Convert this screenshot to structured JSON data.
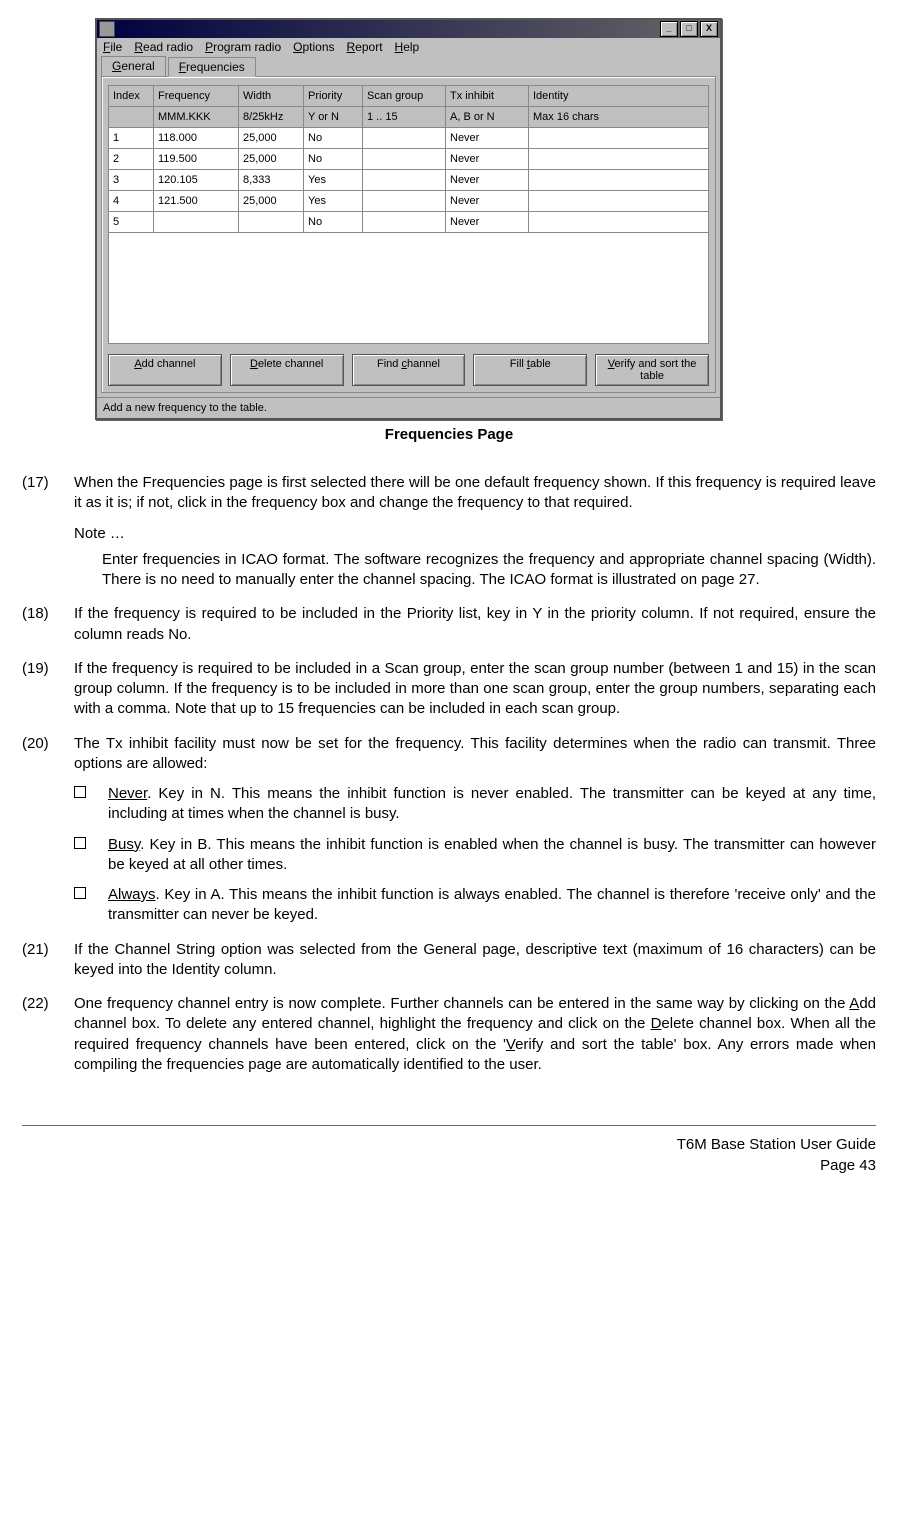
{
  "window": {
    "menus": [
      "File",
      "Read radio",
      "Program radio",
      "Options",
      "Report",
      "Help"
    ],
    "menu_underline_idx": [
      0,
      0,
      0,
      0,
      0,
      0
    ],
    "tabs": [
      "General",
      "Frequencies"
    ],
    "active_tab": 1,
    "win_buttons": [
      "_",
      "□",
      "X"
    ],
    "table": {
      "headers": [
        "Index",
        "Frequency",
        "Width",
        "Priority",
        "Scan group",
        "Tx inhibit",
        "Identity"
      ],
      "hints": [
        "",
        "MMM.KKK",
        "8/25kHz",
        "Y or N",
        "1 .. 15",
        "A, B or N",
        "Max 16 chars"
      ],
      "rows": [
        [
          "1",
          "118.000",
          "25,000",
          "No",
          "",
          "Never",
          ""
        ],
        [
          "2",
          "119.500",
          "25,000",
          "No",
          "",
          "Never",
          ""
        ],
        [
          "3",
          "120.105",
          "8,333",
          "Yes",
          "",
          "Never",
          ""
        ],
        [
          "4",
          "121.500",
          "25,000",
          "Yes",
          "",
          "Never",
          ""
        ],
        [
          "5",
          "",
          "",
          "No",
          "",
          "Never",
          ""
        ]
      ]
    },
    "buttons": [
      "Add channel",
      "Delete channel",
      "Find channel",
      "Fill table",
      "Verify and sort the table"
    ],
    "button_underline_idx": [
      0,
      0,
      5,
      5,
      0
    ],
    "status": "Add a new frequency to the table."
  },
  "caption": "Frequencies Page",
  "items": [
    {
      "num": "(17)",
      "text": "When the Frequencies page is first selected there will be one default frequency shown. If this frequency is required leave it as it is; if not, click in the frequency box and change the frequency to that required.",
      "note_label": "Note …",
      "note": "Enter frequencies in ICAO format. The software recognizes the frequency and appropriate channel spacing (Width). There is no need to manually enter the channel spacing. The ICAO format is illustrated on page 27."
    },
    {
      "num": "(18)",
      "text": "If the frequency is required to be included in the Priority list, key in Y in the priority column. If not required, ensure the column reads No."
    },
    {
      "num": "(19)",
      "text": "If the frequency is required to be included in a Scan group, enter the scan group number (between 1 and 15) in the scan group column. If the frequency is to be included in more than one scan group, enter the group numbers, separating each with a comma. Note that up to 15 frequencies can be included in each scan group."
    },
    {
      "num": "(20)",
      "text": "The Tx inhibit facility must now be set for the frequency. This facility determines when the radio can transmit. Three options are allowed:",
      "subs": [
        {
          "u": "Never",
          "rest": ".  Key in N.  This means the inhibit function is never enabled. The transmitter can be keyed at any time, including at times when the channel is busy."
        },
        {
          "u": "Busy",
          "rest": ". Key in B.  This means the inhibit function is enabled when the channel is busy. The transmitter can however be keyed at all other times."
        },
        {
          "u": "Always",
          "rest": ". Key in A.  This means the inhibit function is always enabled. The channel is therefore 'receive only' and the transmitter can never be keyed."
        }
      ]
    },
    {
      "num": "(21)",
      "text": "If the Channel String option was selected from the General page, descriptive text (maximum of 16 characters) can be keyed into the Identity column."
    },
    {
      "num": "(22)",
      "html": "One frequency channel entry is now complete. Further channels can be entered in the same way by clicking on the <u>A</u>dd channel box. To delete any entered channel, highlight the frequency and click on the <u>D</u>elete channel box. When all the required frequency channels have been entered, click on the '<u>V</u>erify and sort the table' box. Any errors made when compiling the frequencies page are automatically identified to the user."
    }
  ],
  "footer": {
    "line1": "T6M Base Station User Guide",
    "line2": "Page 43"
  }
}
